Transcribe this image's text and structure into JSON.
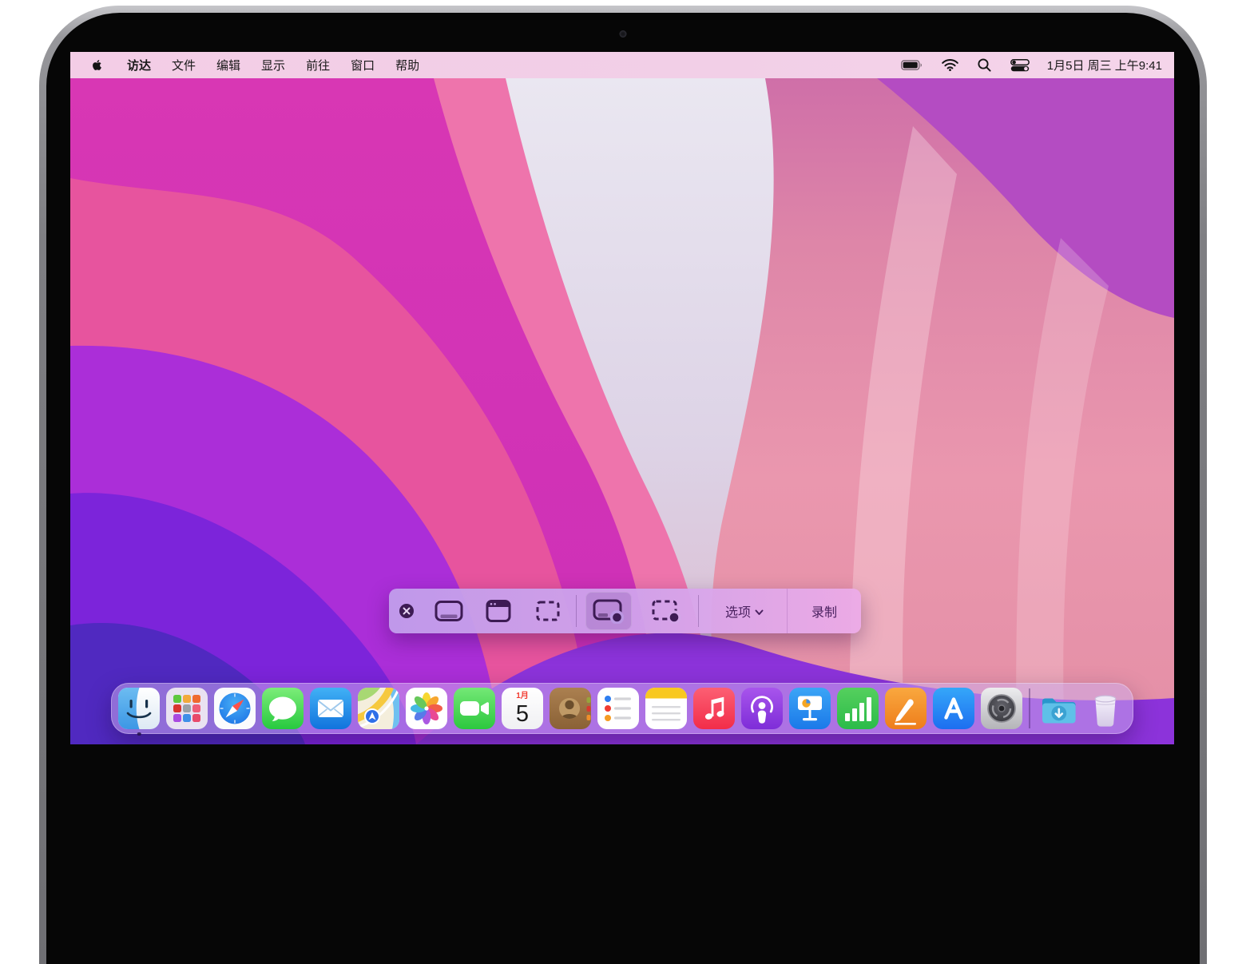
{
  "menu_bar": {
    "apple_logo_icon": "apple-logo-icon",
    "items": [
      {
        "label": "访达",
        "active": true
      },
      {
        "label": "文件",
        "active": false
      },
      {
        "label": "编辑",
        "active": false
      },
      {
        "label": "显示",
        "active": false
      },
      {
        "label": "前往",
        "active": false
      },
      {
        "label": "窗口",
        "active": false
      },
      {
        "label": "帮助",
        "active": false
      }
    ],
    "status_icons": [
      "battery-icon",
      "wifi-icon",
      "spotlight-search-icon",
      "control-center-icon"
    ],
    "clock": "1月5日 周三 上午9:41"
  },
  "capture_toolbar": {
    "close_icon": "close-icon",
    "capture_buttons": [
      {
        "name": "capture-entire-screen",
        "selected": false
      },
      {
        "name": "capture-selected-window",
        "selected": false
      },
      {
        "name": "capture-selected-portion",
        "selected": false
      }
    ],
    "record_buttons": [
      {
        "name": "record-entire-screen",
        "selected": true
      },
      {
        "name": "record-selected-portion",
        "selected": false
      }
    ],
    "options_label": "选项",
    "record_label": "录制"
  },
  "dock": {
    "apps": [
      "finder",
      "launchpad",
      "safari",
      "messages",
      "mail",
      "maps",
      "photos",
      "facetime",
      "calendar",
      "contacts",
      "reminders",
      "notes",
      "music",
      "podcasts",
      "keynote",
      "numbers",
      "pages",
      "app-store",
      "system-preferences"
    ],
    "finder_running": true,
    "calendar_badge": {
      "month": "1月",
      "day": "5"
    },
    "right_items": [
      "downloads-folder",
      "trash"
    ]
  },
  "colors": {
    "menu_bar_bg": "#f2cfe7",
    "toolbar_icon": "#3d1b54",
    "dock_bg": "rgba(203,173,238,0.52)",
    "wallpaper_magenta": "#d837b4",
    "wallpaper_pink": "#ea97ae",
    "wallpaper_violet": "#ab2ed8",
    "wallpaper_purple": "#7c24da",
    "wallpaper_indigo": "#5029c0",
    "record_highlight": "rgba(74,28,120,0.16)"
  }
}
